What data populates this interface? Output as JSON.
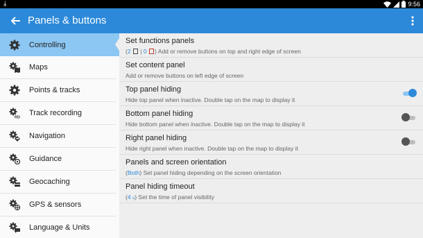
{
  "statusbar": {
    "time": "9:56",
    "icons": [
      "download-icon",
      "wifi-icon",
      "signal-icon",
      "battery-icon"
    ]
  },
  "appbar": {
    "title": "Panels & buttons",
    "back_icon": "arrow-back-icon",
    "menu_icon": "more-vert-icon"
  },
  "colors": {
    "accent": "#2c89d9",
    "selected": "#8cc6f3"
  },
  "sidebar": {
    "items": [
      {
        "label": "Controlling",
        "icon": "gear-icon",
        "active": true
      },
      {
        "label": "Maps",
        "icon": "maps-gear-icon"
      },
      {
        "label": "Points & tracks",
        "icon": "gear-icon"
      },
      {
        "label": "Track recording",
        "icon": "rec-gear-icon"
      },
      {
        "label": "Navigation",
        "icon": "navigation-gear-icon"
      },
      {
        "label": "Guidance",
        "icon": "guidance-gear-icon"
      },
      {
        "label": "Geocaching",
        "icon": "geocaching-gear-icon"
      },
      {
        "label": "GPS & sensors",
        "icon": "gps-gear-icon"
      },
      {
        "label": "Language & Units",
        "icon": "language-gear-icon"
      }
    ]
  },
  "settings": {
    "functions_panels": {
      "title": "Set functions panels",
      "count_top": "2",
      "sep": "|",
      "count_right": "0",
      "open": "(",
      "close": ")",
      "desc": "Add or remove buttons on top and right edge of screen"
    },
    "content_panel": {
      "title": "Set content panel",
      "desc": "Add or remove buttons on left edge of screen"
    },
    "top_hiding": {
      "title": "Top panel hiding",
      "desc": "Hide top panel when inactive. Double tap on the map to display it",
      "enabled": true
    },
    "bottom_hiding": {
      "title": "Bottom panel hiding",
      "desc": "Hide bottom panel when inactive. Double tap on the map to display it",
      "enabled": false
    },
    "right_hiding": {
      "title": "Right panel hiding",
      "desc": "Hide right panel when inactive. Double tap on the map to display it",
      "enabled": false
    },
    "orientation": {
      "title": "Panels and screen orientation",
      "value": "Both",
      "open": "(",
      "close": ")",
      "desc": "Set panel hiding depending on the screen orientation"
    },
    "timeout": {
      "title": "Panel hiding timeout",
      "value": "4",
      "unit": "s",
      "open": "(",
      "close": ")",
      "desc": "Set the time of panel visibility"
    }
  }
}
